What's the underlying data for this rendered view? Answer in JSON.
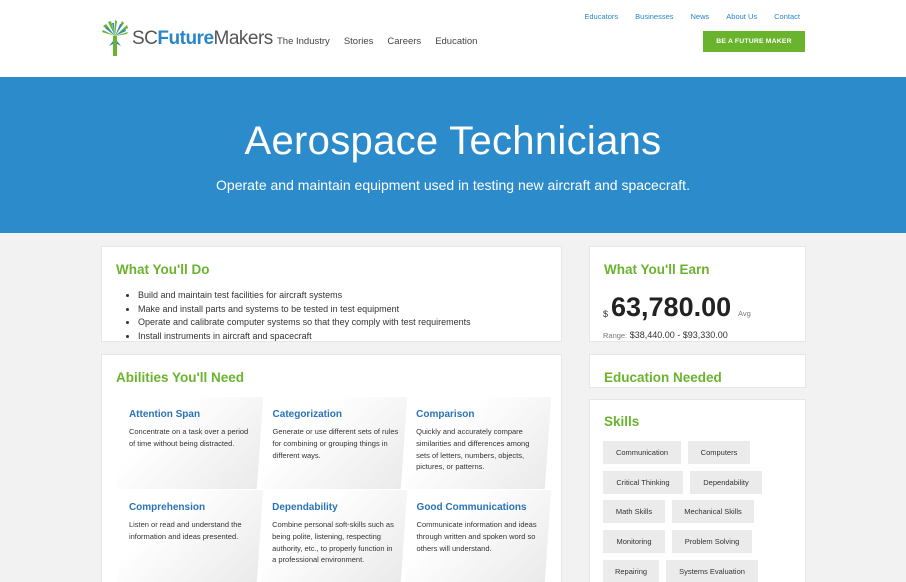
{
  "header": {
    "logo": {
      "sc": "SC",
      "future": "Future",
      "makers": "Makers"
    },
    "main_nav": [
      "The Industry",
      "Stories",
      "Careers",
      "Education"
    ],
    "top_nav": [
      "Educators",
      "Businesses",
      "News",
      "About Us",
      "Contact"
    ],
    "cta_label": "BE A FUTURE MAKER"
  },
  "hero": {
    "title": "Aerospace Technicians",
    "subtitle": "Operate and maintain equipment used in testing new aircraft and spacecraft."
  },
  "what_youll_do": {
    "heading": "What You'll Do",
    "items": [
      "Build and maintain test facilities for aircraft systems",
      "Make and install parts and systems to be tested in test equipment",
      "Operate and calibrate computer systems so that they comply with test requirements",
      "Install instruments in aircraft and spacecraft"
    ]
  },
  "earnings": {
    "heading": "What You'll Earn",
    "currency": "$",
    "amount": "63,780.00",
    "avg_label": "Avg",
    "range_label": "Range:",
    "range_value": "$38,440.00 - $93,330.00"
  },
  "abilities": {
    "heading": "Abilities You'll Need",
    "items": [
      {
        "title": "Attention Span",
        "desc": "Concentrate on a task over a period of time without being distracted."
      },
      {
        "title": "Categorization",
        "desc": "Generate or use different sets of rules for combining or grouping things in different ways."
      },
      {
        "title": "Comparison",
        "desc": "Quickly and accurately compare similarities and differences among sets of letters, numbers, objects, pictures, or patterns."
      },
      {
        "title": "Comprehension",
        "desc": "Listen or read and understand the information and ideas presented."
      },
      {
        "title": "Dependability",
        "desc": "Combine personal soft-skills such as being polite, listening, respecting authority, etc., to properly function in a professional environment."
      },
      {
        "title": "Good Communications",
        "desc": "Communicate information and ideas through written and spoken word so others will understand."
      }
    ]
  },
  "education": {
    "heading": "Education Needed"
  },
  "skills": {
    "heading": "Skills",
    "items": [
      "Communication",
      "Computers",
      "Critical Thinking",
      "Dependability",
      "Math Skills",
      "Mechanical Skills",
      "Monitoring",
      "Problem Solving",
      "Repairing",
      "Systems Evaluation"
    ]
  },
  "colors": {
    "brand_blue": "#2b8bcb",
    "brand_green": "#6ab42d",
    "title_blue": "#2a73b8"
  }
}
